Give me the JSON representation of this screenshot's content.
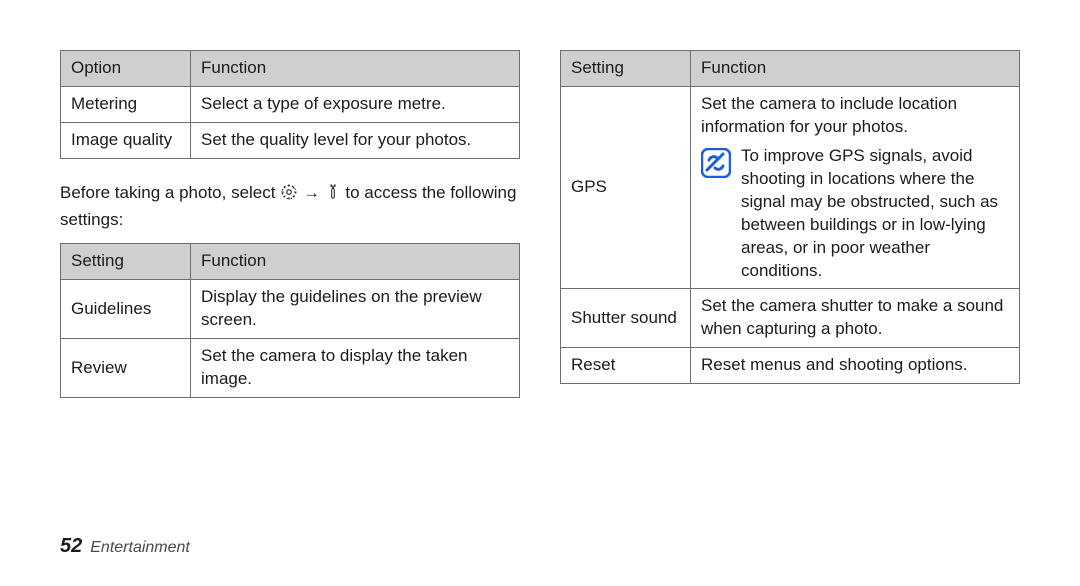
{
  "left": {
    "table1": {
      "headers": [
        "Option",
        "Function"
      ],
      "rows": [
        {
          "opt": "Metering",
          "func": "Select a type of exposure metre."
        },
        {
          "opt": "Image quality",
          "func": "Set the quality level for your photos."
        }
      ]
    },
    "intro_pre": "Before taking a photo, select ",
    "intro_mid": " → ",
    "intro_post": " to access the following settings:",
    "table2": {
      "headers": [
        "Setting",
        "Function"
      ],
      "rows": [
        {
          "opt": "Guidelines",
          "func": "Display the guidelines on the preview screen."
        },
        {
          "opt": "Review",
          "func": "Set the camera to display the taken image."
        }
      ]
    }
  },
  "right": {
    "table": {
      "headers": [
        "Setting",
        "Function"
      ],
      "gps_opt": "GPS",
      "gps_line": "Set the camera to include location information for your photos.",
      "gps_note": "To improve GPS signals, avoid shooting in locations where the signal may be obstructed, such as between buildings or in low-lying areas, or in poor weather conditions.",
      "rows": [
        {
          "opt": "Shutter sound",
          "func": "Set the camera shutter to make a sound when capturing a photo."
        },
        {
          "opt": "Reset",
          "func": "Reset menus and shooting options."
        }
      ]
    }
  },
  "footer": {
    "page": "52",
    "section": "Entertainment"
  }
}
